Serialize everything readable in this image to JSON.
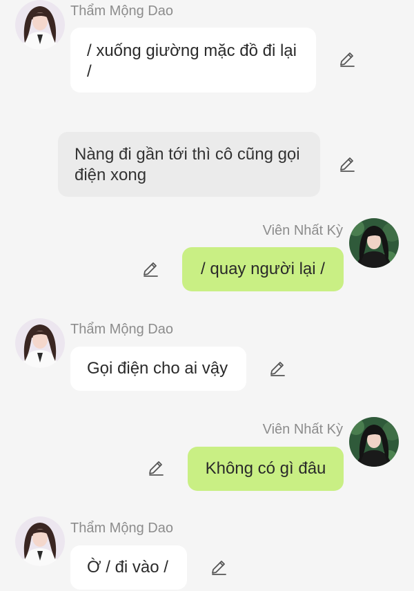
{
  "messages": [
    {
      "type": "incoming",
      "sender": "Thẩm Mộng Dao",
      "avatar_icon": "girl-white-shirt-avatar",
      "text": "/ xuống giường mặc đồ đi lại /"
    },
    {
      "type": "narration",
      "text": "Nàng đi gần tới thì cô cũng gọi điện xong"
    },
    {
      "type": "outgoing",
      "sender": "Viên Nhất Kỳ",
      "avatar_icon": "girl-dark-hair-green-background-avatar",
      "text": "/ quay người lại /"
    },
    {
      "type": "incoming",
      "sender": "Thẩm Mộng Dao",
      "avatar_icon": "girl-white-shirt-avatar",
      "text": "Gọi điện cho ai vậy"
    },
    {
      "type": "outgoing",
      "sender": "Viên Nhất Kỳ",
      "avatar_icon": "girl-dark-hair-green-background-avatar",
      "text": "Không có gì đâu"
    },
    {
      "type": "incoming",
      "sender": "Thẩm Mộng Dao",
      "avatar_icon": "girl-white-shirt-avatar",
      "text": "Ờ / đi vào /"
    }
  ],
  "edit_icon": "pencil-edit-icon",
  "colors": {
    "background": "#f5f5f5",
    "incoming_bubble": "#ffffff",
    "narration_bubble": "#ebebeb",
    "outgoing_bubble": "#c9ef84",
    "name_text": "#8c8c8c",
    "message_text": "#2a2a2a"
  }
}
